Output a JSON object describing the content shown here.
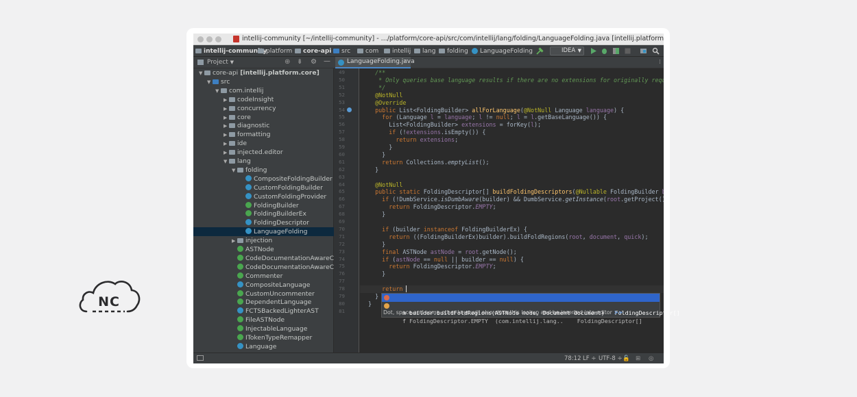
{
  "logo": {
    "text": "NC"
  },
  "window": {
    "title": "intellij-community [~/intellij-community] - .../platform/core-api/src/com/intellij/lang/folding/LanguageFolding.java [intellij.platform.core]"
  },
  "navbar": {
    "crumbs": [
      "intellij-community",
      "platform",
      "core-api",
      "src",
      "com",
      "intellij",
      "lang",
      "folding",
      "LanguageFolding"
    ],
    "run_config": "IDEA"
  },
  "sidebar": {
    "header": "Project",
    "tree": [
      {
        "label": "core-api",
        "bold_suffix": "[intellij.platform.core]",
        "kind": "module",
        "indent": 0,
        "arrow": "▼"
      },
      {
        "label": "src",
        "kind": "src",
        "indent": 1,
        "arrow": "▼"
      },
      {
        "label": "com.intellij",
        "kind": "folder",
        "indent": 2,
        "arrow": "▼"
      },
      {
        "label": "codeInsight",
        "kind": "folder",
        "indent": 3,
        "arrow": "▶"
      },
      {
        "label": "concurrency",
        "kind": "folder",
        "indent": 3,
        "arrow": "▶"
      },
      {
        "label": "core",
        "kind": "folder",
        "indent": 3,
        "arrow": "▶"
      },
      {
        "label": "diagnostic",
        "kind": "folder",
        "indent": 3,
        "arrow": "▶"
      },
      {
        "label": "formatting",
        "kind": "folder",
        "indent": 3,
        "arrow": "▶"
      },
      {
        "label": "ide",
        "kind": "folder",
        "indent": 3,
        "arrow": "▶"
      },
      {
        "label": "injected.editor",
        "kind": "folder",
        "indent": 3,
        "arrow": "▶"
      },
      {
        "label": "lang",
        "kind": "folder",
        "indent": 3,
        "arrow": "▼"
      },
      {
        "label": "folding",
        "kind": "folder",
        "indent": 4,
        "arrow": "▼"
      },
      {
        "label": "CompositeFoldingBuilder",
        "kind": "class",
        "indent": 5,
        "arrow": ""
      },
      {
        "label": "CustomFoldingBuilder",
        "kind": "class",
        "indent": 5,
        "arrow": ""
      },
      {
        "label": "CustomFoldingProvider",
        "kind": "class",
        "indent": 5,
        "arrow": ""
      },
      {
        "label": "FoldingBuilder",
        "kind": "interface",
        "indent": 5,
        "arrow": ""
      },
      {
        "label": "FoldingBuilderEx",
        "kind": "interface",
        "indent": 5,
        "arrow": ""
      },
      {
        "label": "FoldingDescriptor",
        "kind": "class",
        "indent": 5,
        "arrow": ""
      },
      {
        "label": "LanguageFolding",
        "kind": "class",
        "indent": 5,
        "arrow": "",
        "selected": true
      },
      {
        "label": "injection",
        "kind": "folder",
        "indent": 4,
        "arrow": "▶"
      },
      {
        "label": "ASTNode",
        "kind": "interface",
        "indent": 4,
        "arrow": ""
      },
      {
        "label": "CodeDocumentationAwareCo",
        "kind": "interface",
        "indent": 4,
        "arrow": ""
      },
      {
        "label": "CodeDocumentationAwareCo",
        "kind": "interface",
        "indent": 4,
        "arrow": ""
      },
      {
        "label": "Commenter",
        "kind": "interface",
        "indent": 4,
        "arrow": ""
      },
      {
        "label": "CompositeLanguage",
        "kind": "class",
        "indent": 4,
        "arrow": ""
      },
      {
        "label": "CustomUncommenter",
        "kind": "interface",
        "indent": 4,
        "arrow": ""
      },
      {
        "label": "DependentLanguage",
        "kind": "interface",
        "indent": 4,
        "arrow": ""
      },
      {
        "label": "FCTSBackedLighterAST",
        "kind": "class",
        "indent": 4,
        "arrow": ""
      },
      {
        "label": "FileASTNode",
        "kind": "interface",
        "indent": 4,
        "arrow": ""
      },
      {
        "label": "InjectableLanguage",
        "kind": "interface",
        "indent": 4,
        "arrow": ""
      },
      {
        "label": "ITokenTypeRemapper",
        "kind": "interface",
        "indent": 4,
        "arrow": ""
      },
      {
        "label": "Language",
        "kind": "class",
        "indent": 4,
        "arrow": ""
      }
    ]
  },
  "editor": {
    "tab": "LanguageFolding.java",
    "lines": [
      {
        "n": "49",
        "html": "  <span style=\"color:#629755;font-style:italic\">/**</span>"
      },
      {
        "n": "50",
        "html": "   <span style=\"color:#629755;font-style:italic\">* Only queries base language results if there are no extensions for originally requested</span>"
      },
      {
        "n": "51",
        "html": "   <span style=\"color:#629755;font-style:italic\">*/</span>"
      },
      {
        "n": "52",
        "html": "  <span style=\"color:#bbb529\">@NotNull</span>"
      },
      {
        "n": "53",
        "html": "  <span style=\"color:#bbb529\">@Override</span>"
      },
      {
        "n": "54",
        "html": "  <span style=\"color:#cc7832\">public</span> List&lt;FoldingBuilder&gt; <span style=\"color:#ffc66d\">allForLanguage</span>(<span style=\"color:#bbb529\">@NotNull</span> Language <span style=\"color:#9876aa\">language</span>) {"
      },
      {
        "n": "55",
        "html": "    <span style=\"color:#cc7832\">for</span> (Language <span style=\"color:#9876aa\">l</span> = <span style=\"color:#9876aa\">language</span>; <span style=\"color:#9876aa\">l</span> != <span style=\"color:#cc7832\">null</span>; <span style=\"color:#9876aa\">l</span> = <span style=\"color:#9876aa\">l</span>.getBaseLanguage()) {"
      },
      {
        "n": "56",
        "html": "      List&lt;FoldingBuilder&gt; <span style=\"color:#9876aa\">extensions</span> = forKey(<span style=\"color:#9876aa\">l</span>);"
      },
      {
        "n": "57",
        "html": "      <span style=\"color:#cc7832\">if</span> (!<span style=\"color:#9876aa\">extensions</span>.isEmpty()) {"
      },
      {
        "n": "58",
        "html": "        <span style=\"color:#cc7832\">return</span> <span style=\"color:#9876aa\">extensions</span>;"
      },
      {
        "n": "59",
        "html": "      }"
      },
      {
        "n": "60",
        "html": "    }"
      },
      {
        "n": "61",
        "html": "    <span style=\"color:#cc7832\">return</span> Collections.<span style=\"font-style:italic\">emptyList</span>();"
      },
      {
        "n": "62",
        "html": "  }"
      },
      {
        "n": "63",
        "html": ""
      },
      {
        "n": "64",
        "html": "  <span style=\"color:#bbb529\">@NotNull</span>"
      },
      {
        "n": "65",
        "html": "  <span style=\"color:#cc7832\">public static</span> FoldingDescriptor[] <span style=\"color:#ffc66d\">buildFoldingDescriptors</span>(<span style=\"color:#bbb529\">@Nullable</span> FoldingBuilder <span style=\"color:#9876aa\">builder</span>"
      },
      {
        "n": "66",
        "html": "    <span style=\"color:#cc7832\">if</span> (!DumbService.<span style=\"font-style:italic\">isDumbAware</span>(builder) &amp;&amp; DumbService.<span style=\"font-style:italic\">getInstance</span>(<span style=\"color:#9876aa\">root</span>.getProject()).isDum"
      },
      {
        "n": "67",
        "html": "      <span style=\"color:#cc7832\">return</span> FoldingDescriptor.<span style=\"color:#9876aa;font-style:italic\">EMPTY</span>;"
      },
      {
        "n": "68",
        "html": "    }"
      },
      {
        "n": "69",
        "html": ""
      },
      {
        "n": "70",
        "html": "    <span style=\"color:#cc7832\">if</span> (builder <span style=\"color:#cc7832\">instanceof</span> FoldingBuilderEx) {"
      },
      {
        "n": "71",
        "html": "      <span style=\"color:#cc7832\">return</span> ((FoldingBuilderEx)builder).buildFoldRegions(<span style=\"color:#9876aa\">root</span>, <span style=\"color:#9876aa\">document</span>, <span style=\"color:#9876aa\">quick</span>);"
      },
      {
        "n": "72",
        "html": "    }"
      },
      {
        "n": "73",
        "html": "    <span style=\"color:#cc7832\">final</span> ASTNode <span style=\"color:#9876aa\">astNode</span> = <span style=\"color:#9876aa\">root</span>.getNode();"
      },
      {
        "n": "74",
        "html": "    <span style=\"color:#cc7832\">if</span> (<span style=\"color:#9876aa\">astNode</span> == <span style=\"color:#cc7832\">null</span> || builder == <span style=\"color:#cc7832\">null</span>) {"
      },
      {
        "n": "75",
        "html": "      <span style=\"color:#cc7832\">return</span> FoldingDescriptor.<span style=\"color:#9876aa;font-style:italic\">EMPTY</span>;"
      },
      {
        "n": "76",
        "html": "    }"
      },
      {
        "n": "77",
        "html": ""
      },
      {
        "n": "78",
        "html": "    <span style=\"color:#cc7832\">return</span> <span class=\"caret\"></span>"
      },
      {
        "n": "79",
        "html": "  }"
      },
      {
        "n": "80",
        "html": "}"
      },
      {
        "n": "81",
        "html": ""
      }
    ]
  },
  "completion": {
    "items": [
      {
        "text": "  m builder.buildFoldRegions(ASTNode node, Document document)   FoldingDescriptor[]",
        "selected": true
      },
      {
        "text": "  f FoldingDescriptor.EMPTY  (com.intellij.lang..    FoldingDescriptor[]",
        "selected": false
      }
    ],
    "hint": "Dot, space and some other keys will also close this lookup and be inserted into editor",
    "hint_link": ">>"
  },
  "status": {
    "position": "78:12",
    "line_sep": "LF ÷",
    "encoding": "UTF-8 ÷"
  }
}
